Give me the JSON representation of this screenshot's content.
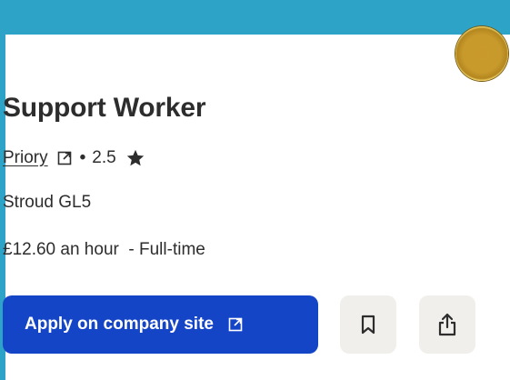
{
  "job": {
    "title": "Support Worker",
    "company": "Priory",
    "separator": "•",
    "rating": "2.5",
    "location": "Stroud GL5",
    "salary": "£12.60 an hour",
    "job_type": "  - Full-time"
  },
  "actions": {
    "apply_label": "Apply on company site",
    "save_icon": "bookmark-icon",
    "share_icon": "share-icon"
  },
  "colors": {
    "background": "#2da3c8",
    "card": "#ffffff",
    "apply_button": "#1545c7",
    "icon_button": "#f1efec",
    "text": "#2d2d2d"
  }
}
